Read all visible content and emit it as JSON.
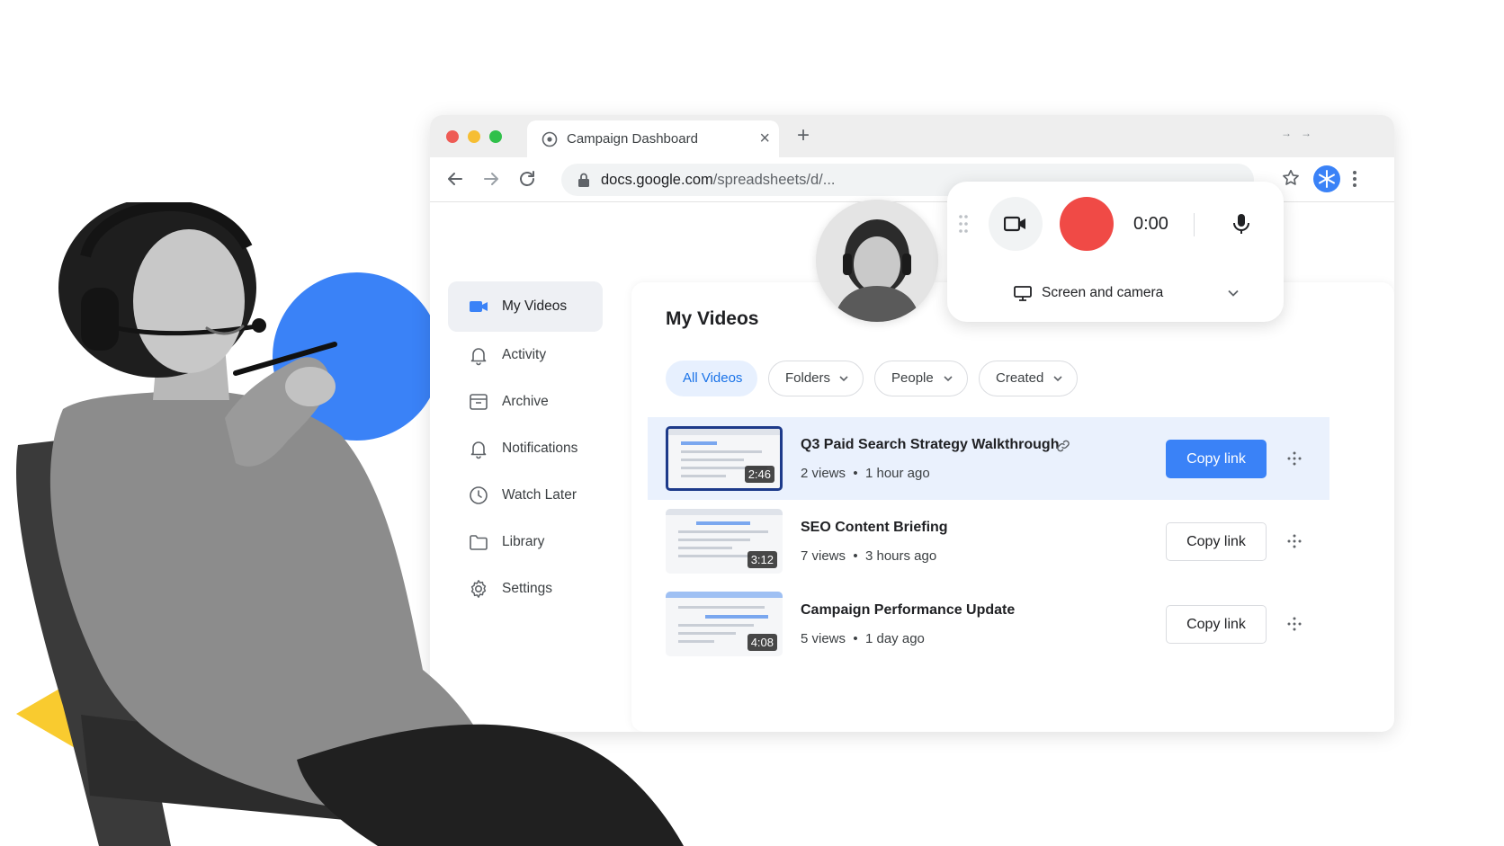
{
  "browser": {
    "tab_title": "Campaign Dashboard",
    "url_domain": "docs.google.com",
    "url_path": "/spreadsheets/d/..."
  },
  "sidebar": {
    "items": [
      {
        "label": "My Videos",
        "icon": "video-camera-icon",
        "active": true
      },
      {
        "label": "Activity",
        "icon": "bell-icon"
      },
      {
        "label": "Archive",
        "icon": "archive-box-icon"
      },
      {
        "label": "Notifications",
        "icon": "bell-icon"
      },
      {
        "label": "Watch Later",
        "icon": "clock-icon"
      },
      {
        "label": "Library",
        "icon": "folder-icon"
      },
      {
        "label": "Settings",
        "icon": "gear-icon"
      }
    ]
  },
  "main": {
    "title": "My Videos",
    "filters": [
      {
        "label": "All Videos",
        "active": true
      },
      {
        "label": "Folders",
        "dropdown": true
      },
      {
        "label": "People",
        "dropdown": true
      },
      {
        "label": "Created",
        "dropdown": true
      }
    ],
    "videos": [
      {
        "title": "Q3 Paid Search Strategy Walkthrough",
        "duration": "2:46",
        "views": "2 views",
        "age": "1 hour ago",
        "selected": true,
        "copy_label": "Copy link"
      },
      {
        "title": "SEO Content Briefing",
        "duration": "3:12",
        "views": "7 views",
        "age": "3 hours ago",
        "copy_label": "Copy link"
      },
      {
        "title": "Campaign Performance Update",
        "duration": "4:08",
        "views": "5 views",
        "age": "1 day ago",
        "copy_label": "Copy link"
      }
    ],
    "meta_separator": "•"
  },
  "recorder": {
    "timer": "0:00",
    "mode_label": "Screen and camera",
    "record_color": "#f04a46"
  },
  "colors": {
    "accent": "#3a82f7",
    "shape_blue": "#3a82f7",
    "shape_yellow": "#f9cb2f"
  }
}
